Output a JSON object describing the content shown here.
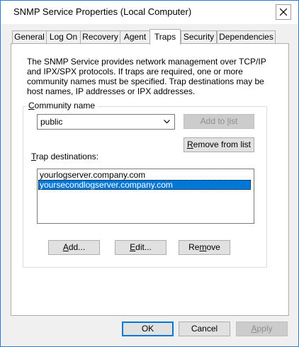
{
  "window": {
    "title": "SNMP Service Properties (Local Computer)"
  },
  "tabs": [
    {
      "label": "General",
      "active": false
    },
    {
      "label": "Log On",
      "active": false
    },
    {
      "label": "Recovery",
      "active": false
    },
    {
      "label": "Agent",
      "active": false
    },
    {
      "label": "Traps",
      "active": true
    },
    {
      "label": "Security",
      "active": false
    },
    {
      "label": "Dependencies",
      "active": false
    }
  ],
  "traps": {
    "description": "The SNMP Service provides network management over TCP/IP and IPX/SPX protocols. If traps are required, one or more community names must be specified. Trap destinations may be host names, IP addresses or IPX addresses.",
    "community": {
      "legend_prefix": "",
      "legend_access": "C",
      "legend_rest": "ommunity name",
      "selected_value": "public",
      "add_to_list": {
        "prefix": "Add to ",
        "access": "l",
        "rest": "ist",
        "enabled": false
      },
      "remove_from_list": {
        "prefix": "",
        "access": "R",
        "rest": "emove from list",
        "enabled": true
      }
    },
    "trap_destinations": {
      "label_prefix": "",
      "label_access": "T",
      "label_rest": "rap destinations:",
      "items": [
        {
          "text": "yourlogserver.company.com",
          "selected": false
        },
        {
          "text": "yoursecondlogserver.company.com",
          "selected": true
        }
      ],
      "add": {
        "prefix": "",
        "access": "A",
        "rest": "dd..."
      },
      "edit": {
        "prefix": "",
        "access": "E",
        "rest": "dit..."
      },
      "remove": {
        "prefix": "Re",
        "access": "m",
        "rest": "ove"
      }
    }
  },
  "footer": {
    "ok": "OK",
    "cancel": "Cancel",
    "apply_access": "A",
    "apply_rest": "pply",
    "apply_enabled": false
  },
  "colors": {
    "accent": "#0078d7",
    "window_border": "#2b79d8",
    "selection": "#0078d7"
  }
}
